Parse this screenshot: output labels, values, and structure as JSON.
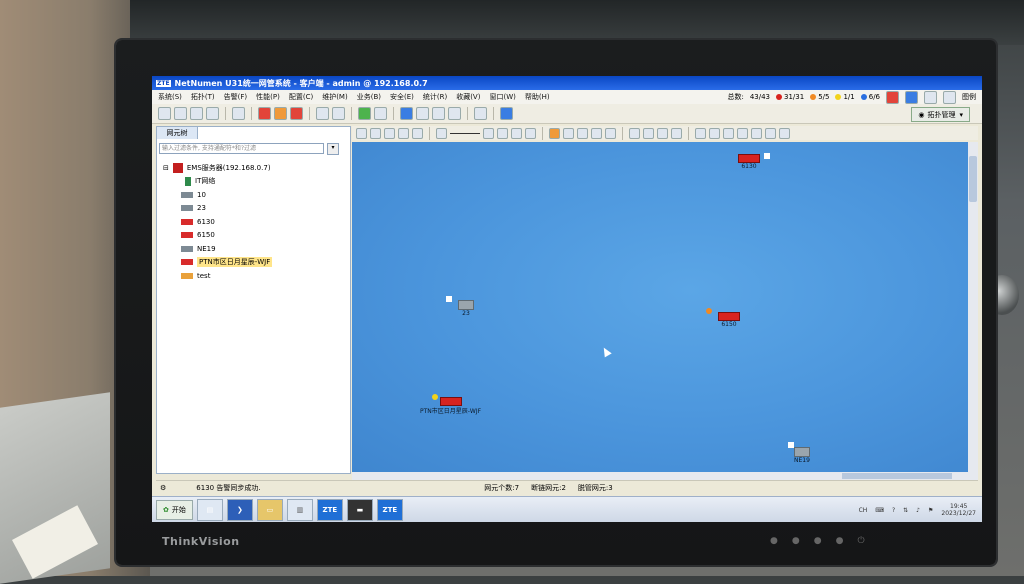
{
  "window": {
    "title": "NetNumen U31统一网管系统 - 客户端 - admin @ 192.168.0.7",
    "logo": "ZTE"
  },
  "menu": [
    "系统(S)",
    "拓扑(T)",
    "告警(F)",
    "性能(P)",
    "配置(C)",
    "维护(M)",
    "业务(B)",
    "安全(E)",
    "统计(R)",
    "收藏(V)",
    "窗口(W)",
    "帮助(H)"
  ],
  "stats": {
    "total_label": "总数:",
    "total_value": "43/43",
    "critical": "31/31",
    "major": "5/5",
    "minor": "1/1",
    "warning": "6/6",
    "legend_label": "图例"
  },
  "toolbar": {
    "topo_manage_label": "拓扑管理"
  },
  "left_panel": {
    "tab_label": "网元树",
    "filter_placeholder": "输入过滤条件, 支持通配符*和?过滤",
    "tree": [
      {
        "label": "EMS服务器(192.168.0.7)",
        "icon": "server-icon",
        "level": 0
      },
      {
        "label": "IT网络",
        "icon": "network-folder-icon",
        "level": 1
      },
      {
        "label": "10",
        "icon": "device-icon",
        "level": 1
      },
      {
        "label": "23",
        "icon": "device-icon",
        "level": 1
      },
      {
        "label": "6130",
        "icon": "device-icon",
        "level": 1
      },
      {
        "label": "6150",
        "icon": "device-icon",
        "level": 1
      },
      {
        "label": "NE19",
        "icon": "device-icon",
        "level": 1
      },
      {
        "label": "PTN市区日月星辰-WJF",
        "icon": "device-icon",
        "level": 1,
        "selected": true
      },
      {
        "label": "test",
        "icon": "device-icon",
        "level": 1
      }
    ]
  },
  "canvas": {
    "elements": [
      {
        "label": "6130",
        "status": "critical"
      },
      {
        "label": "23",
        "status": "normal"
      },
      {
        "label": "6150",
        "status": "critical"
      },
      {
        "label": "PTN市区日月星辰-WJF",
        "status": "critical"
      },
      {
        "label": "NE19",
        "status": "normal"
      }
    ]
  },
  "statusbar": {
    "message": "6130 告警同步成功.",
    "ne_count": "网元个数:7",
    "disconnected": "断链网元:2",
    "unmanaged": "脱管网元:3"
  },
  "taskbar": {
    "start_label": "开始",
    "tasks": [
      "ZTE",
      "ZTE"
    ],
    "tray_lang": "CH",
    "time": "19:45",
    "date": "2023/12/27"
  },
  "monitor": {
    "brand": "ThinkVision"
  },
  "colors": {
    "canvas_bg": "#4b95dc",
    "critical": "#d8231f",
    "major": "#f08a24",
    "minor": "#f2d31b",
    "warning": "#2b6fe0",
    "titlebar": "#0a47c4"
  }
}
